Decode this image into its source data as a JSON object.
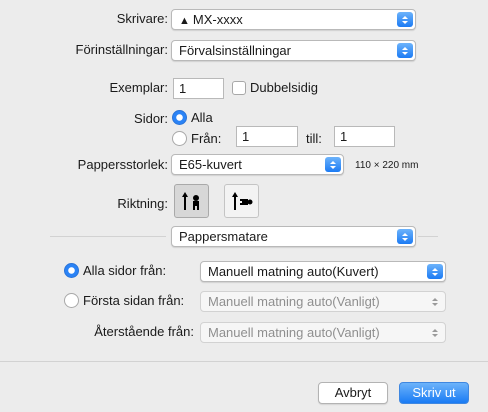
{
  "printer": {
    "label": "Skrivare:",
    "value": "MX-xxxx",
    "icon": "warning-icon"
  },
  "presets": {
    "label": "Förinställningar:",
    "value": "Förvalsinställningar"
  },
  "copies": {
    "label": "Exemplar:",
    "value": "1",
    "duplex_label": "Dubbelsidig",
    "duplex_checked": false
  },
  "pages": {
    "label": "Sidor:",
    "all_label": "Alla",
    "from_label": "Från:",
    "from_value": "1",
    "to_label": "till:",
    "to_value": "1",
    "selected": "all"
  },
  "paper_size": {
    "label": "Pappersstorlek:",
    "value": "E65-kuvert",
    "dimensions": "110 × 220 mm"
  },
  "orientation": {
    "label": "Riktning:",
    "selected": "portrait"
  },
  "section": {
    "value": "Pappersmatare"
  },
  "feed": {
    "all_pages_label": "Alla sidor från:",
    "all_pages_value": "Manuell matning auto(Kuvert)",
    "first_page_label": "Första sidan från:",
    "first_page_value": "Manuell matning auto(Vanligt)",
    "remaining_label": "Återstående från:",
    "remaining_value": "Manuell matning auto(Vanligt)",
    "selected": "all_pages"
  },
  "buttons": {
    "cancel": "Avbryt",
    "print": "Skriv ut"
  },
  "colors": {
    "accent": "#1c7bf4",
    "background": "#ececec"
  }
}
